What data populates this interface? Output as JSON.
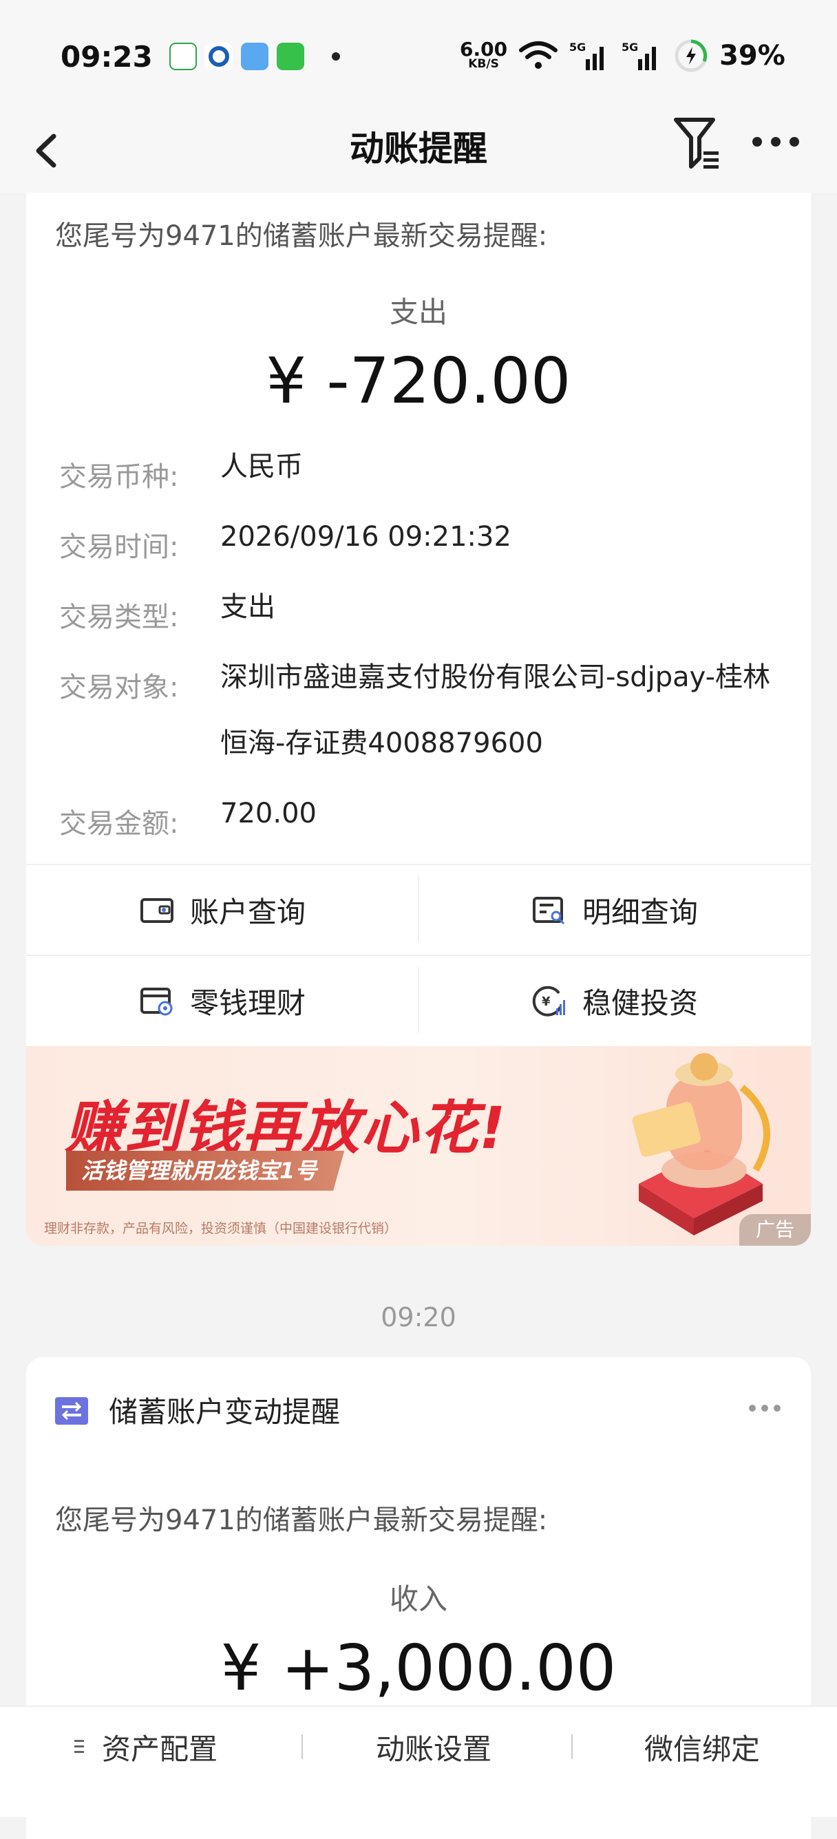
{
  "status_bar": {
    "time": "09:23",
    "speed_value": "6.00",
    "speed_unit": "KB/S",
    "battery": "39%"
  },
  "header": {
    "title": "动账提醒"
  },
  "notice1": {
    "intro": "您尾号为9471的储蓄账户最新交易提醒:",
    "kind": "支出",
    "amount": "¥ -720.00",
    "rows": [
      {
        "label": "交易币种:",
        "value": "人民币"
      },
      {
        "label": "交易时间:",
        "value": "2026/09/16 09:21:32"
      },
      {
        "label": "交易类型:",
        "value": "支出"
      },
      {
        "label": "交易对象:",
        "value": "深圳市盛迪嘉支付股份有限公司-sdjpay-桂林恒海-存证费4008879600"
      },
      {
        "label": "交易金额:",
        "value": "720.00"
      }
    ],
    "buttons": [
      "账户查询",
      "明细查询",
      "零钱理财",
      "稳健投资"
    ]
  },
  "banner": {
    "headline": "赚到钱再放心花!",
    "sub": "活钱管理就用龙钱宝1号",
    "note": "理财非存款，产品有风险，投资须谨慎（中国建设银行代销）",
    "ad": "广告"
  },
  "timestamp2": "09:20",
  "notice2": {
    "title": "储蓄账户变动提醒",
    "intro": "您尾号为9471的储蓄账户最新交易提醒:",
    "kind": "收入",
    "amount": "¥ +3,000.00"
  },
  "bottom_bar": {
    "items": [
      "资产配置",
      "动账设置",
      "微信绑定"
    ]
  },
  "colors": {
    "accent_red": "#e3232f",
    "card_bg": "#ffffff",
    "page_bg": "#f3f3f3"
  }
}
